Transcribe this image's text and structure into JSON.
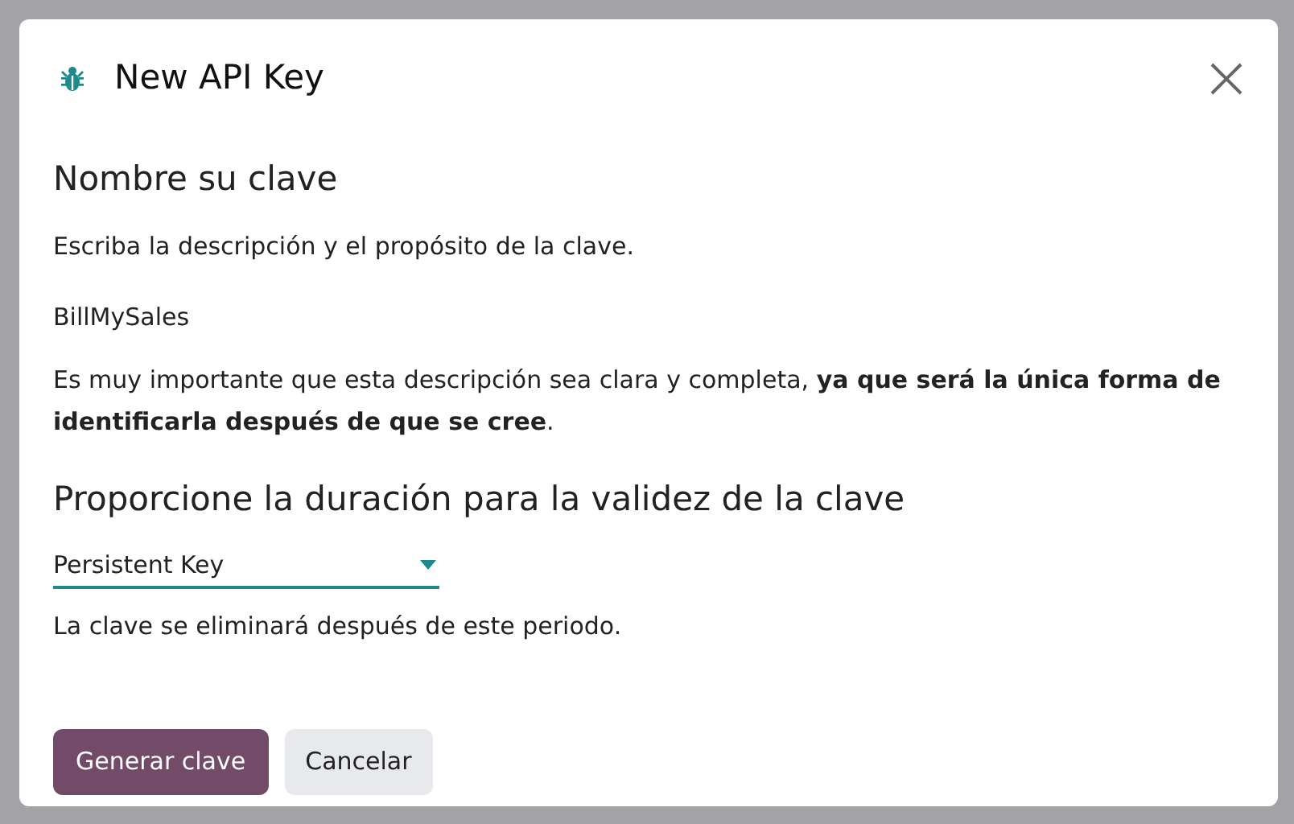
{
  "dialog": {
    "title": "New API Key",
    "name_section": {
      "heading": "Nombre su clave",
      "description": "Escriba la descripción y el propósito de la clave.",
      "value": "BillMySales",
      "note": "Es muy importante que esta descripción sea clara y completa, **ya que será la única forma de identificarla después de que se cree**."
    },
    "duration_section": {
      "heading": "Proporcione la duración para la validez de la clave",
      "select_value": "Persistent Key",
      "help": "La clave se eliminará después de este periodo."
    },
    "buttons": [
      {
        "label": "Generar clave",
        "kind": "primary"
      },
      {
        "label": "Cancelar",
        "kind": "secondary"
      }
    ]
  }
}
